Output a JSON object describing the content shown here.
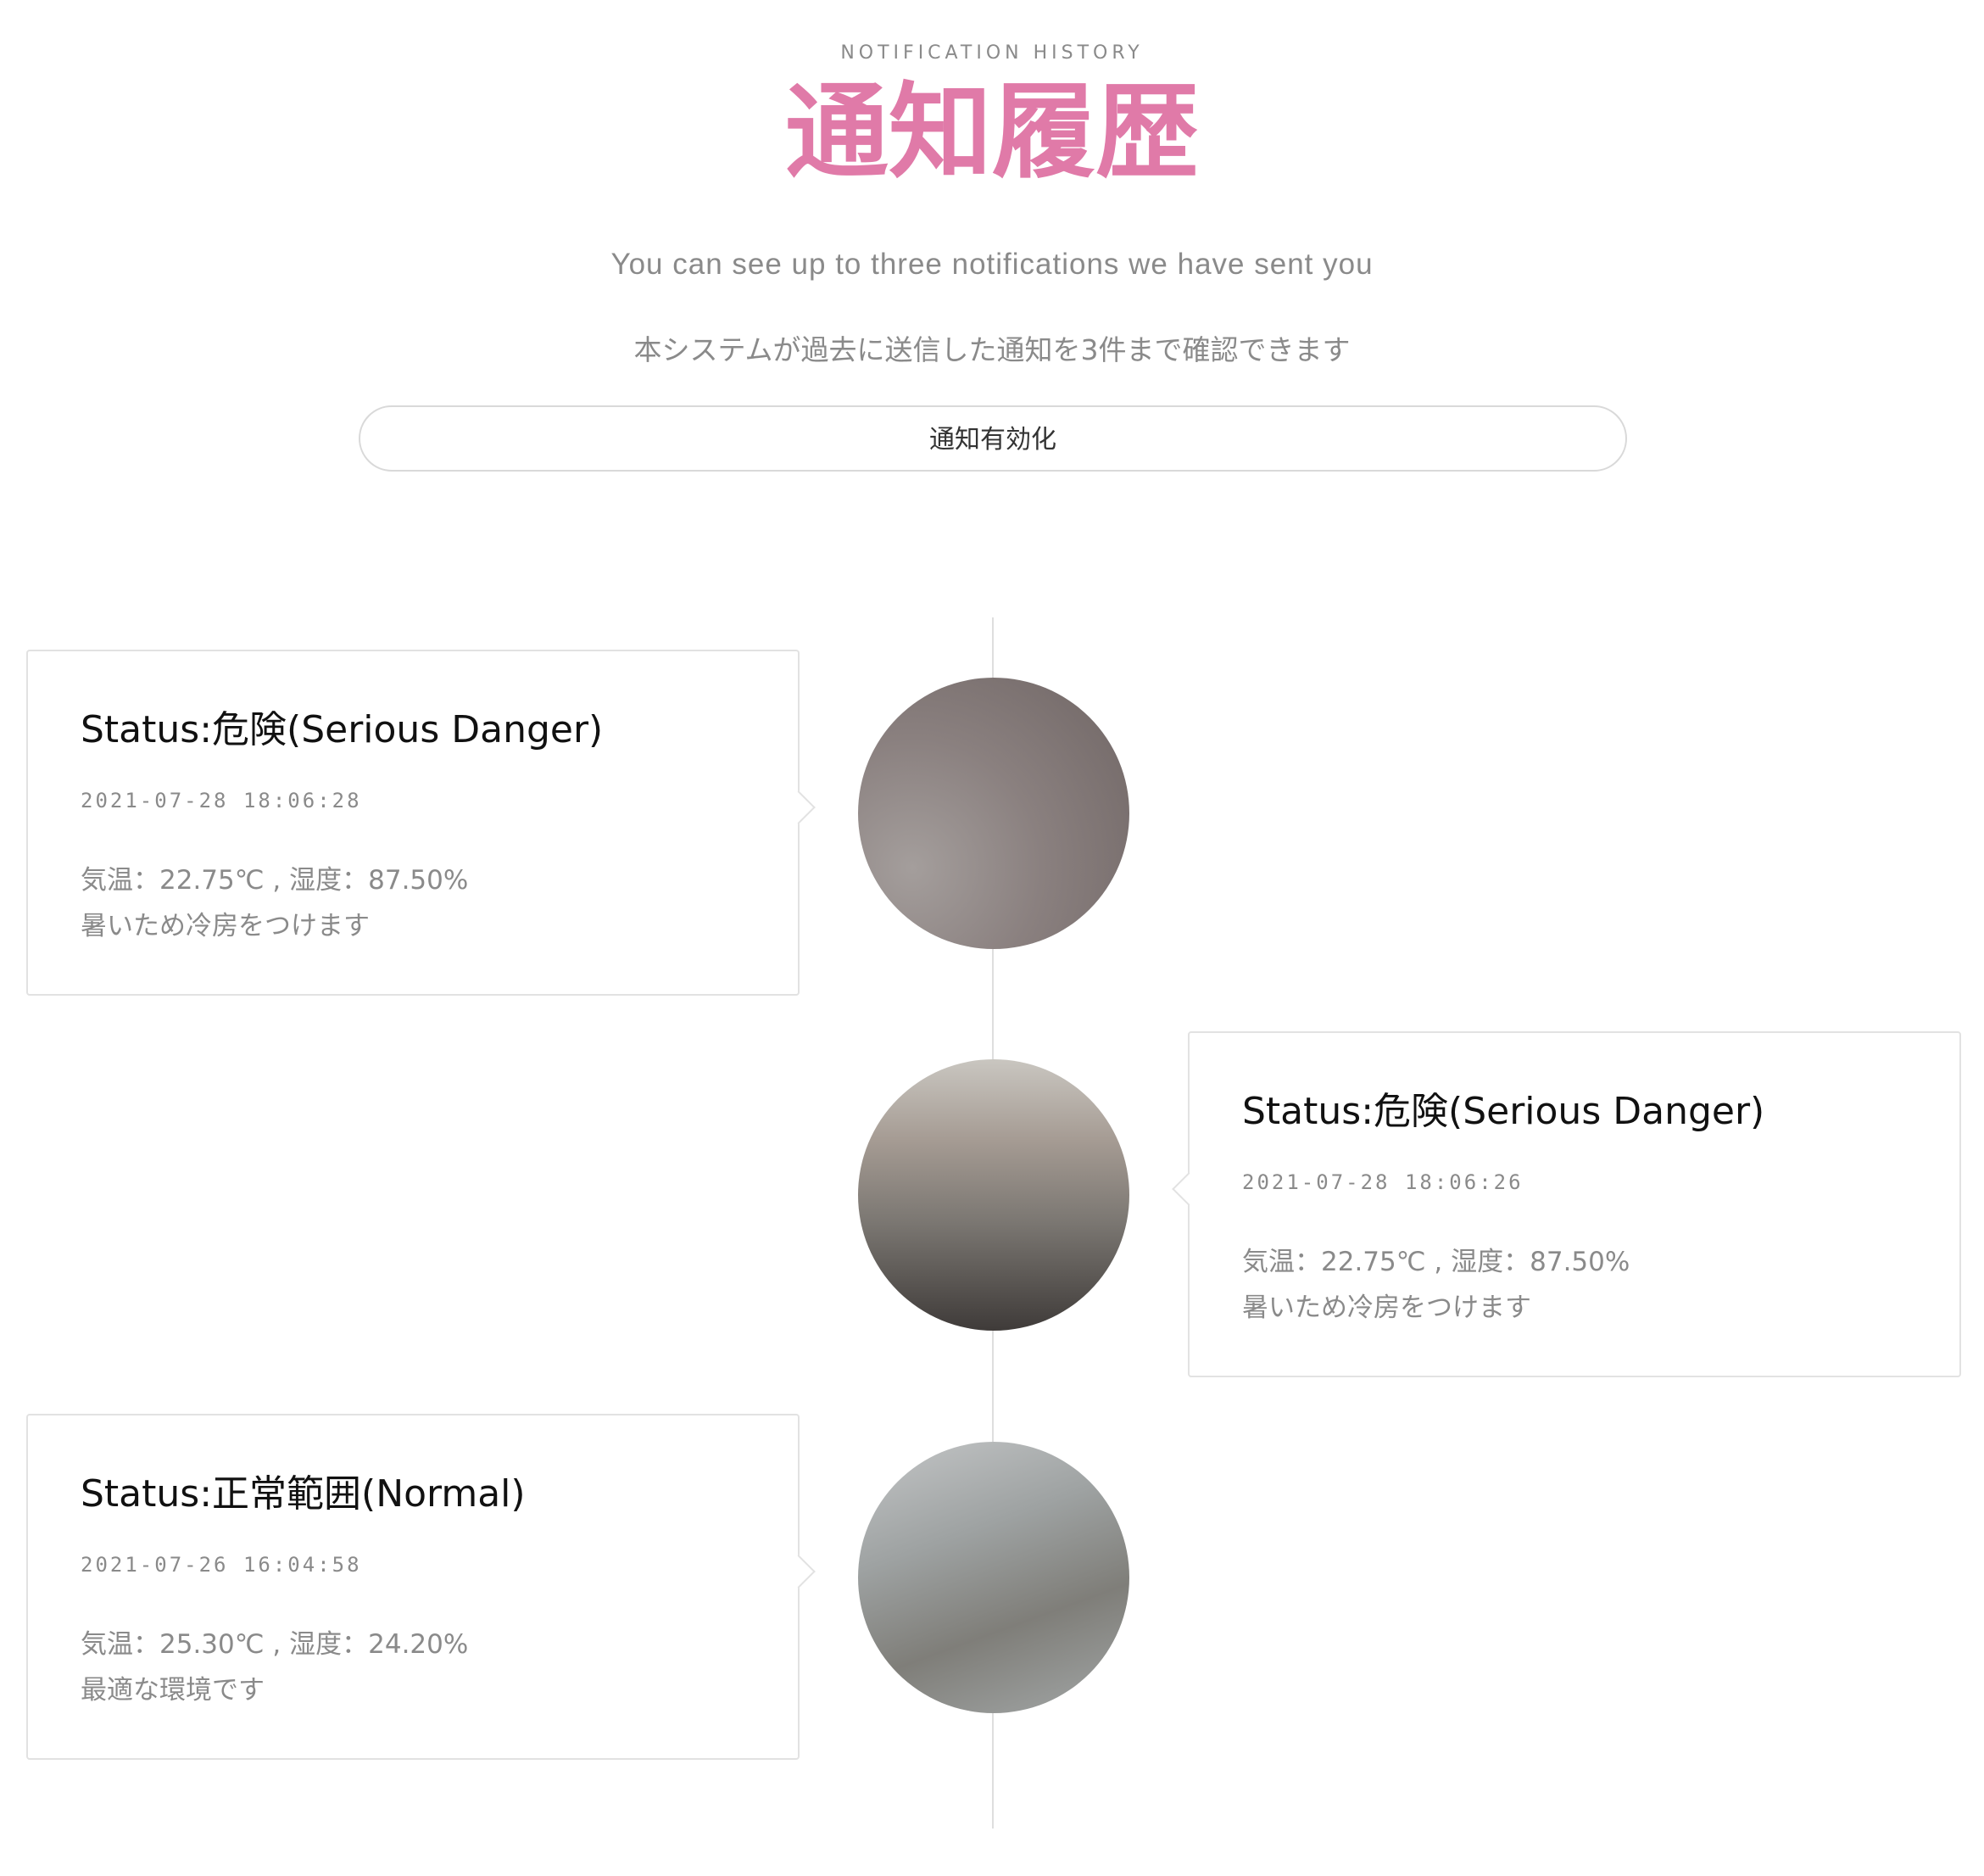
{
  "header": {
    "eyebrow": "NOTIFICATION HISTORY",
    "title": "通知履歴",
    "subtitle_en": "You can see up to three notifications we have sent you",
    "subtitle_ja": "本システムが過去に送信した通知を3件まで確認できます"
  },
  "enable_button": {
    "label": "通知有効化"
  },
  "notifications": [
    {
      "status": "Status:危険(Serious Danger)",
      "date": "2021-07-28 18:06:28",
      "reading": "気温：22.75℃ , 湿度：87.50%",
      "message": "暑いため冷房をつけます"
    },
    {
      "status": "Status:危険(Serious Danger)",
      "date": "2021-07-28 18:06:26",
      "reading": "気温：22.75℃ , 湿度：87.50%",
      "message": "暑いため冷房をつけます"
    },
    {
      "status": "Status:正常範囲(Normal)",
      "date": "2021-07-26 16:04:58",
      "reading": "気温：25.30℃ , 湿度：24.20%",
      "message": "最適な環境です"
    }
  ],
  "colors": {
    "title": "#e07aa8",
    "muted_text": "#8a8a8a",
    "border": "#e2e2e2",
    "timeline": "#dedede"
  }
}
